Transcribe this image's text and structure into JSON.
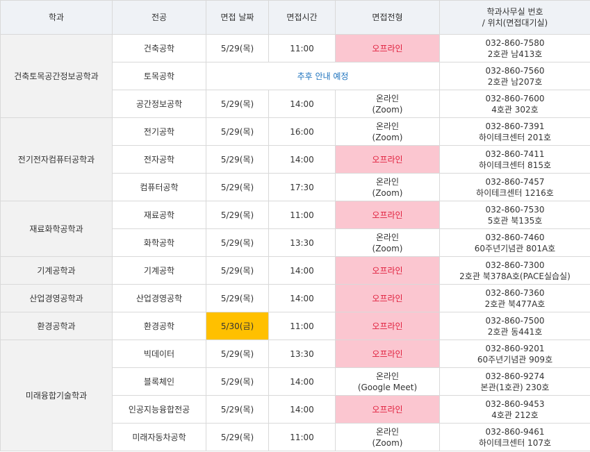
{
  "headers": {
    "dept": "학과",
    "major": "전공",
    "date": "면접 날짜",
    "time": "면접시간",
    "type": "면접전형",
    "contact_line1": "학과사무실 번호",
    "contact_line2": "/ 위치(면접대기실)"
  },
  "colors": {
    "offline_bg": "#fbc6d0",
    "offline_text": "#e01e3c",
    "highlight_bg": "#ffc000",
    "notice_text": "#1e73be",
    "dept_bg": "#f2f2f2",
    "header_bg": "#eff2f6"
  },
  "depts": [
    "건축토목공간정보공학과",
    "전기전자컴퓨터공학과",
    "재료화학공학과",
    "기계공학과",
    "산업경영공학과",
    "환경공학과",
    "미래융합기술학과"
  ],
  "rows": [
    {
      "major": "건축공학",
      "date": "5/29(목)",
      "time": "11:00",
      "type": "오프라인",
      "type2": "",
      "phone": "032-860-7580",
      "location": "2호관 남413호"
    },
    {
      "major": "토목공학",
      "notice": "추후 안내 예정",
      "phone": "032-860-7560",
      "location": "2호관 남207호"
    },
    {
      "major": "공간정보공학",
      "date": "5/29(목)",
      "time": "14:00",
      "type": "온라인",
      "type2": "(Zoom)",
      "phone": "032-860-7600",
      "location": "4호관 302호"
    },
    {
      "major": "전기공학",
      "date": "5/29(목)",
      "time": "16:00",
      "type": "온라인",
      "type2": "(Zoom)",
      "phone": "032-860-7391",
      "location": "하이테크센터 201호"
    },
    {
      "major": "전자공학",
      "date": "5/29(목)",
      "time": "14:00",
      "type": "오프라인",
      "type2": "",
      "phone": "032-860-7411",
      "location": "하이테크센터 815호"
    },
    {
      "major": "컴퓨터공학",
      "date": "5/29(목)",
      "time": "17:30",
      "type": "온라인",
      "type2": "(Zoom)",
      "phone": "032-860-7457",
      "location": "하이테크센터 1216호"
    },
    {
      "major": "재료공학",
      "date": "5/29(목)",
      "time": "11:00",
      "type": "오프라인",
      "type2": "",
      "phone": "032-860-7530",
      "location": "5호관 북135호"
    },
    {
      "major": "화학공학",
      "date": "5/29(목)",
      "time": "13:30",
      "type": "온라인",
      "type2": "(Zoom)",
      "phone": "032-860-7460",
      "location": "60주년기념관 801A호"
    },
    {
      "major": "기계공학",
      "date": "5/29(목)",
      "time": "14:00",
      "type": "오프라인",
      "type2": "",
      "phone": "032-860-7300",
      "location": "2호관 북378A호(PACE실습실)"
    },
    {
      "major": "산업경영공학",
      "date": "5/29(목)",
      "time": "14:00",
      "type": "오프라인",
      "type2": "",
      "phone": "032-860-7360",
      "location": "2호관 북477A호"
    },
    {
      "major": "환경공학",
      "date": "5/30(금)",
      "time": "11:00",
      "type": "오프라인",
      "type2": "",
      "phone": "032-860-7500",
      "location": "2호관 동441호"
    },
    {
      "major": "빅데이터",
      "date": "5/29(목)",
      "time": "13:30",
      "type": "오프라인",
      "type2": "",
      "phone": "032-860-9201",
      "location": "60주년기념관 909호"
    },
    {
      "major": "블록체인",
      "date": "5/29(목)",
      "time": "14:00",
      "type": "온라인",
      "type2": "(Google Meet)",
      "phone": "032-860-9274",
      "location": "본관(1호관) 230호"
    },
    {
      "major": "인공지능융합전공",
      "date": "5/29(목)",
      "time": "14:00",
      "type": "오프라인",
      "type2": "",
      "phone": "032-860-9453",
      "location": "4호관 212호"
    },
    {
      "major": "미래자동차공학",
      "date": "5/29(목)",
      "time": "11:00",
      "type": "온라인",
      "type2": "(Zoom)",
      "phone": "032-860-9461",
      "location": "하이테크센터 107호"
    }
  ]
}
